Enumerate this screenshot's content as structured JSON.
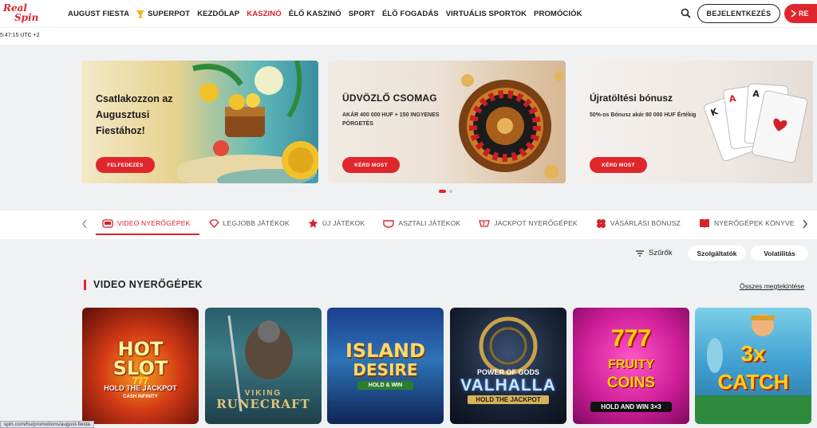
{
  "header": {
    "logo_line1": "Real",
    "logo_line2": "Spin",
    "nav": [
      "AUGUST FIESTA",
      "SUPERPOT",
      "KEZDŐLAP",
      "KASZINÓ",
      "ÉLŐ KASZINÓ",
      "SPORT",
      "ÉLŐ FOGADÁS",
      "VIRTUÁLIS SPORTOK",
      "PROMÓCIÓK"
    ],
    "active_nav": "KASZINÓ",
    "login_label": "BEJELENTKEZÉS",
    "register_label": "RE"
  },
  "clock": "5:47:15 UTC +2",
  "banners": [
    {
      "title": "Csatlakozzon az Augusztusi Fiestához!",
      "subtitle": "",
      "button": "FELFEDEZÉS"
    },
    {
      "title": "ÜDVÖZLŐ CSOMAG",
      "subtitle": "AKÁR 400 000 HUF + 150 INGYENES PÖRGETÉS",
      "button": "KÉRD MOST"
    },
    {
      "title": "Újratöltési bónusz",
      "subtitle": "50%-os Bónusz akár 80 000 HUF Értékig",
      "button": "KÉRD MOST"
    }
  ],
  "carousel": {
    "active_index": 0,
    "count": 2
  },
  "categories": [
    {
      "label": "VIDEO NYERŐGÉPEK",
      "icon": "slot-machine-icon",
      "active": true
    },
    {
      "label": "LEGJOBB JÁTÉKOK",
      "icon": "diamond-icon",
      "active": false
    },
    {
      "label": "ÚJ JÁTÉKOK",
      "icon": "star-icon",
      "active": false
    },
    {
      "label": "ASZTALI JÁTÉKOK",
      "icon": "table-icon",
      "active": false
    },
    {
      "label": "JACKPOT NYERŐGÉPEK",
      "icon": "jackpot-icon",
      "active": false
    },
    {
      "label": "VÁSÁRLÁSI BÓNUSZ",
      "icon": "clover-icon",
      "active": false
    },
    {
      "label": "NYERŐGÉPEK KÖNYVE",
      "icon": "book-icon",
      "active": false
    }
  ],
  "filters": {
    "label": "Szűrők",
    "providers": "Szolgáltatók",
    "volatility": "Volatilitás"
  },
  "section": {
    "title": "VIDEO NYERŐGÉPEK",
    "see_all": "Összes megtekintése"
  },
  "games": [
    {
      "line1": "HOT",
      "line2": "SLOT",
      "line3": "777",
      "line4": "HOLD THE JACKPOT",
      "line5": "CASH INFINITY"
    },
    {
      "line1": "VIKING",
      "line2": "RUNECRAFT"
    },
    {
      "line1": "ISLAND",
      "line2": "DESIRE",
      "line3": "HOLD & WIN"
    },
    {
      "line1": "POWER OF GODS",
      "line2": "VALHALLA",
      "line3": "HOLD THE JACKPOT"
    },
    {
      "line1": "777",
      "line2": "FRUITY",
      "line3": "COINS",
      "line4": "HOLD AND WIN 3×3"
    },
    {
      "line1": "3x",
      "line2": "CATCH"
    }
  ],
  "status_url": "spin.com/hu/promotions/august-fiesta",
  "colors": {
    "brand_red": "#e0262d",
    "background": "#f0f1f3"
  }
}
